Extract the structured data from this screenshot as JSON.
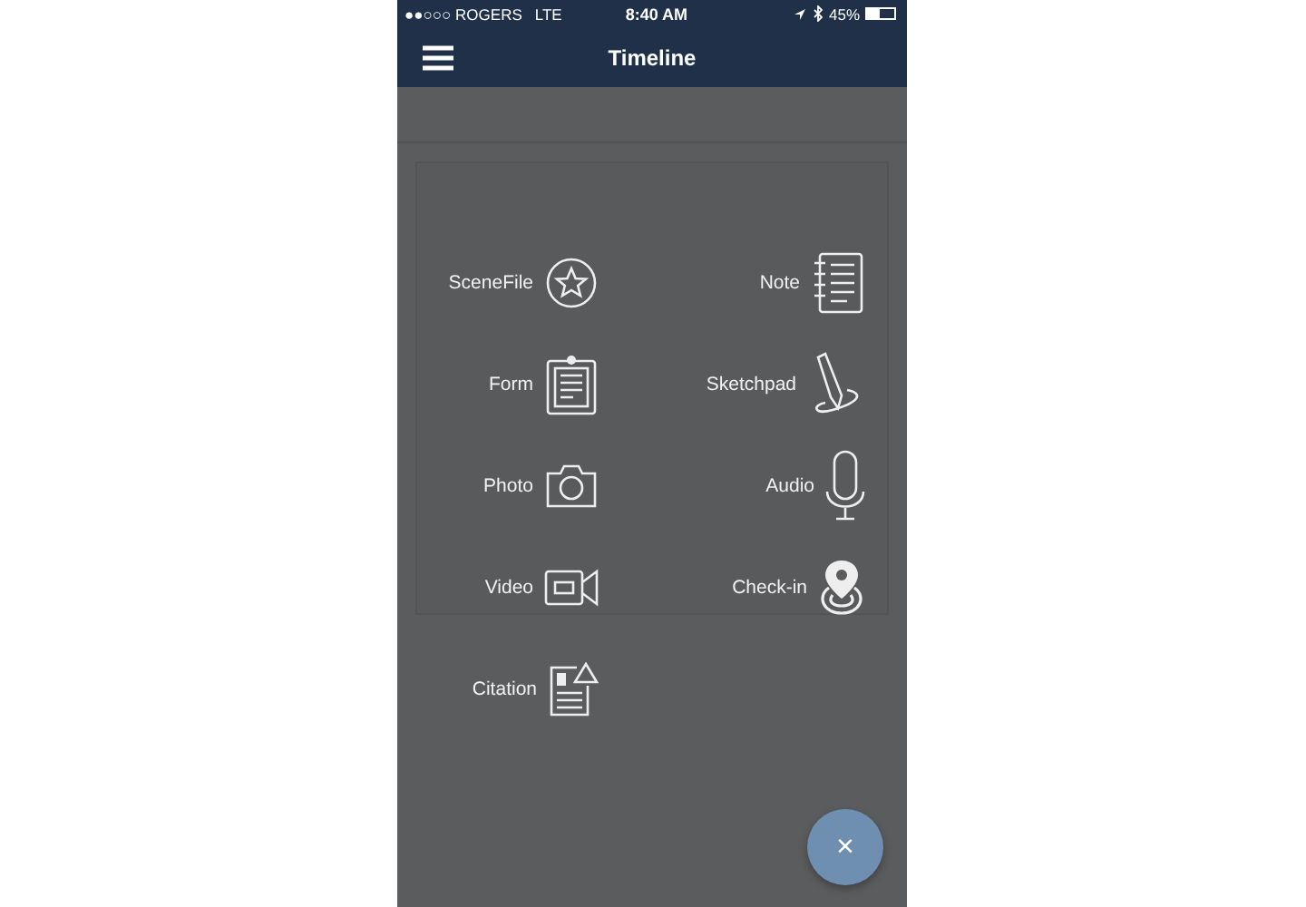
{
  "status_bar": {
    "carrier": "●●○○○ ROGERS",
    "network": "LTE",
    "time": "8:40 AM",
    "battery": "45%"
  },
  "header": {
    "title": "Timeline"
  },
  "actions": [
    {
      "label": "SceneFile",
      "kind": "star"
    },
    {
      "label": "Note",
      "kind": "notebook"
    },
    {
      "label": "Form",
      "kind": "clipboard"
    },
    {
      "label": "Sketchpad",
      "kind": "pencil"
    },
    {
      "label": "Photo",
      "kind": "camera"
    },
    {
      "label": "Audio",
      "kind": "microphone"
    },
    {
      "label": "Video",
      "kind": "video"
    },
    {
      "label": "Check-in",
      "kind": "pin"
    },
    {
      "label": "Citation",
      "kind": "citation"
    }
  ],
  "fab": {
    "label": "×"
  }
}
